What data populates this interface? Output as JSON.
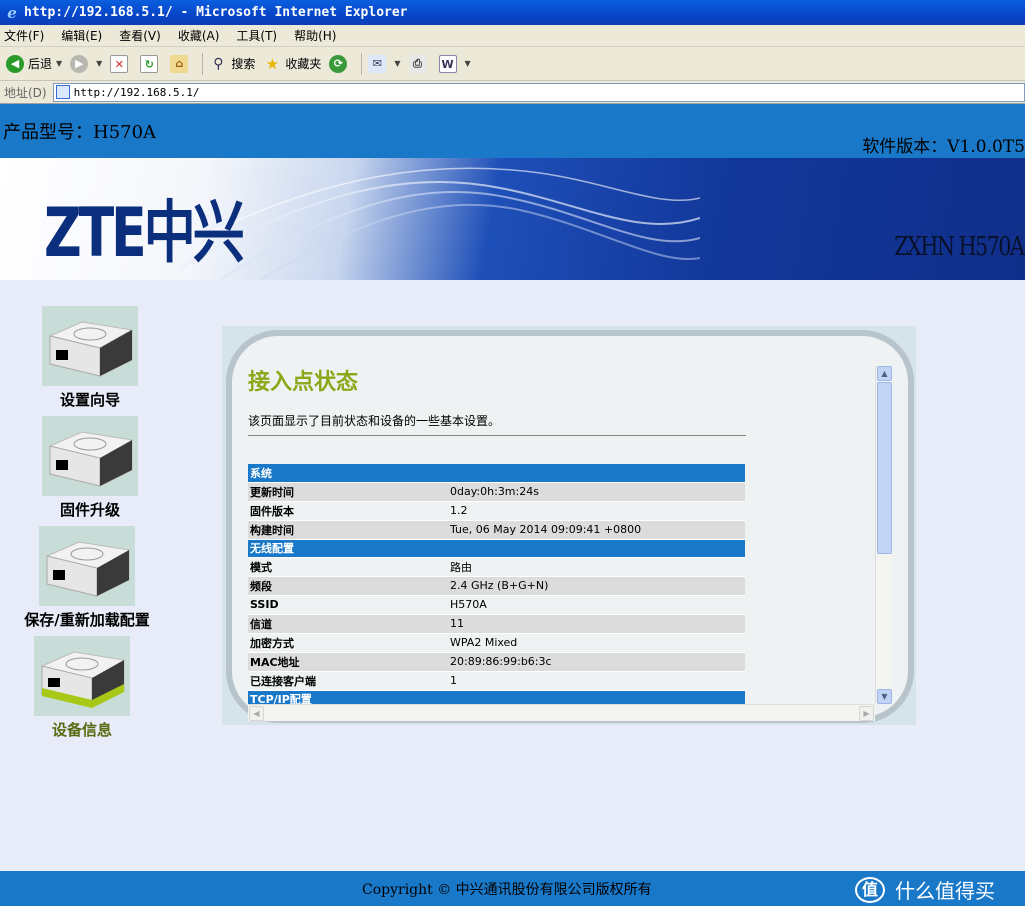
{
  "window": {
    "title": "http://192.168.5.1/ - Microsoft Internet Explorer"
  },
  "menu": [
    "文件(F)",
    "编辑(E)",
    "查看(V)",
    "收藏(A)",
    "工具(T)",
    "帮助(H)"
  ],
  "toolbar": {
    "back": "后退",
    "search": "搜索",
    "favorites": "收藏夹"
  },
  "address": {
    "label": "地址(D)",
    "url": "http://192.168.5.1/"
  },
  "header": {
    "model": "产品型号：H570A",
    "version": "软件版本：V1.0.0T5"
  },
  "banner": {
    "logo": "ZTE中兴",
    "product": "ZXHN H570A"
  },
  "nav": [
    {
      "label": "设置向导"
    },
    {
      "label": "固件升级"
    },
    {
      "label": "保存/重新加载配置"
    },
    {
      "label": "设备信息"
    }
  ],
  "content": {
    "title": "接入点状态",
    "description": "该页面显示了目前状态和设备的一些基本设置。",
    "sections": [
      {
        "name": "系统",
        "rows": [
          {
            "key": "更新时间",
            "value": "0day:0h:3m:24s"
          },
          {
            "key": "固件版本",
            "value": "1.2"
          },
          {
            "key": "构建时间",
            "value": "Tue, 06 May 2014 09:09:41 +0800"
          }
        ]
      },
      {
        "name": "无线配置",
        "rows": [
          {
            "key": "模式",
            "value": "路由"
          },
          {
            "key": "频段",
            "value": "2.4 GHz (B+G+N)"
          },
          {
            "key": "SSID",
            "value": "H570A"
          },
          {
            "key": "信道",
            "value": "11"
          },
          {
            "key": "加密方式",
            "value": "WPA2 Mixed"
          },
          {
            "key": "MAC地址",
            "value": "20:89:86:99:b6:3c"
          },
          {
            "key": "已连接客户端",
            "value": "1"
          }
        ]
      },
      {
        "name": "TCP/IP配置",
        "rows": []
      }
    ]
  },
  "footer": {
    "copyright": "Copyright © 中兴通讯股份有限公司版权所有",
    "watermark": "什么值得买",
    "watermark_mark": "值"
  }
}
